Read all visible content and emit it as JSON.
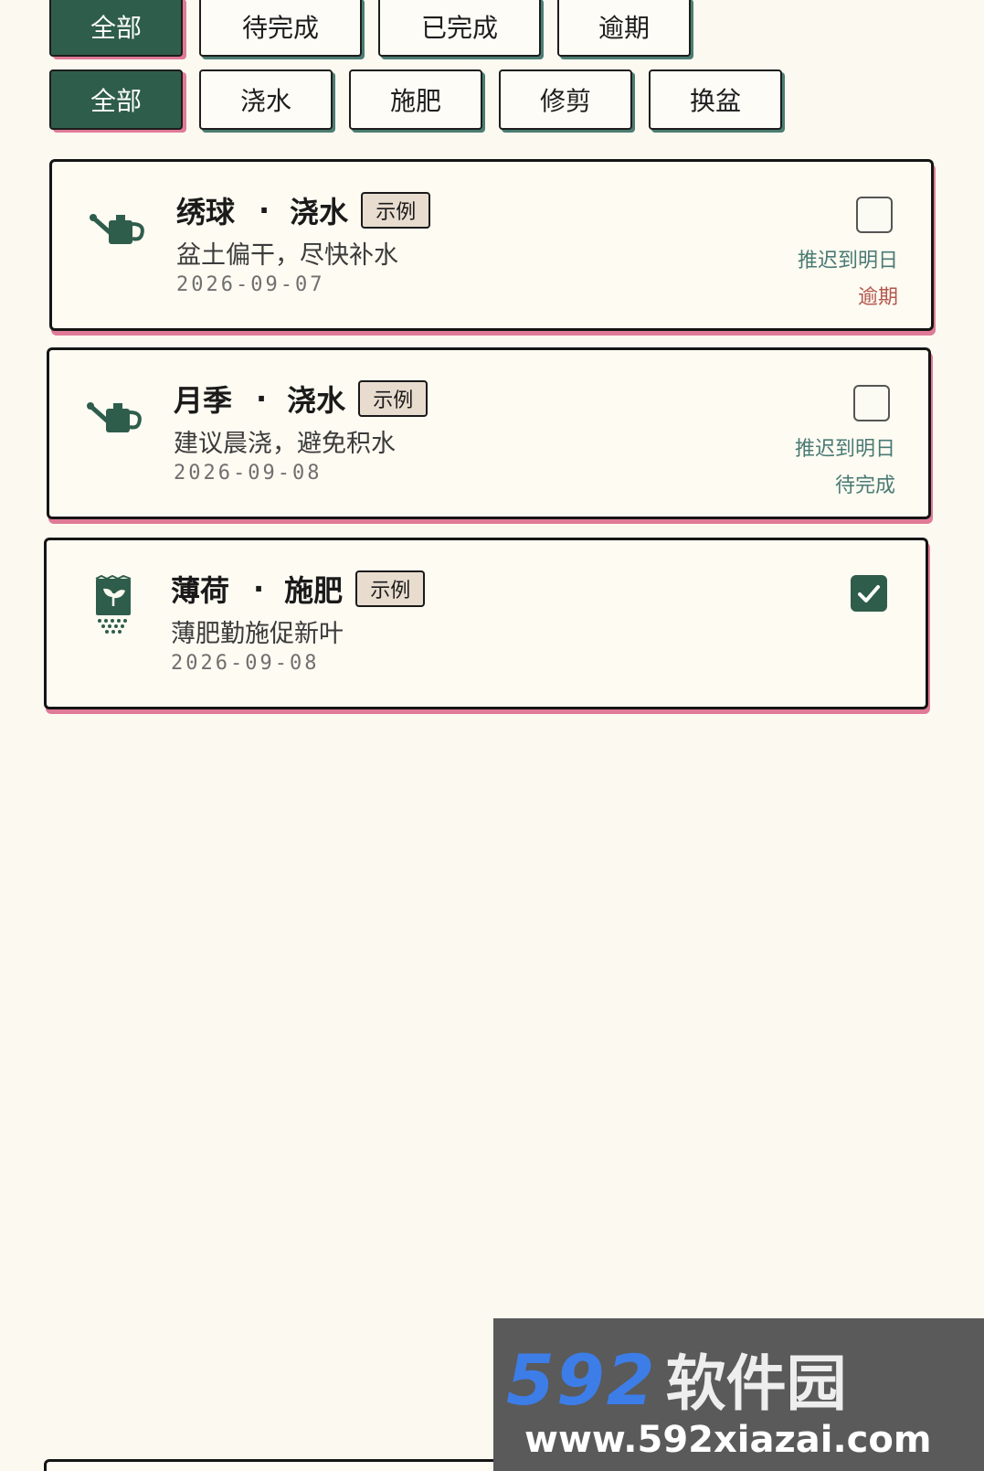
{
  "status_filters": [
    {
      "label": "全部",
      "active": true
    },
    {
      "label": "待完成",
      "active": false
    },
    {
      "label": "已完成",
      "active": false
    },
    {
      "label": "逾期",
      "active": false
    }
  ],
  "type_filters": [
    {
      "label": "全部",
      "active": true
    },
    {
      "label": "浇水",
      "active": false
    },
    {
      "label": "施肥",
      "active": false
    },
    {
      "label": "修剪",
      "active": false
    },
    {
      "label": "换盆",
      "active": false
    }
  ],
  "tasks": [
    {
      "icon": "watering-can-icon",
      "plant": "绣球",
      "separator": "·",
      "action": "浇水",
      "badge": "示例",
      "note": "盆土偏干，尽快补水",
      "date": "2026-09-07",
      "done": false,
      "postpone": "推迟到明日",
      "status": "逾期"
    },
    {
      "icon": "watering-can-icon",
      "plant": "月季",
      "separator": "·",
      "action": "浇水",
      "badge": "示例",
      "note": "建议晨浇，避免积水",
      "date": "2026-09-08",
      "done": false,
      "postpone": "推迟到明日",
      "status": "待完成"
    },
    {
      "icon": "fertilizer-bag-icon",
      "plant": "薄荷",
      "separator": "·",
      "action": "施肥",
      "badge": "示例",
      "note": "薄肥勤施促新叶",
      "date": "2026-09-08",
      "done": true
    }
  ],
  "watermark": {
    "number": "592",
    "name": "软件园",
    "url": "www.592xiazai.com"
  },
  "colors": {
    "primary_green": "#2f5d4c",
    "accent_pink": "#e07a97",
    "overdue_red": "#b3574d",
    "teal_text": "#4a7a74",
    "background": "#fcfaf0"
  }
}
